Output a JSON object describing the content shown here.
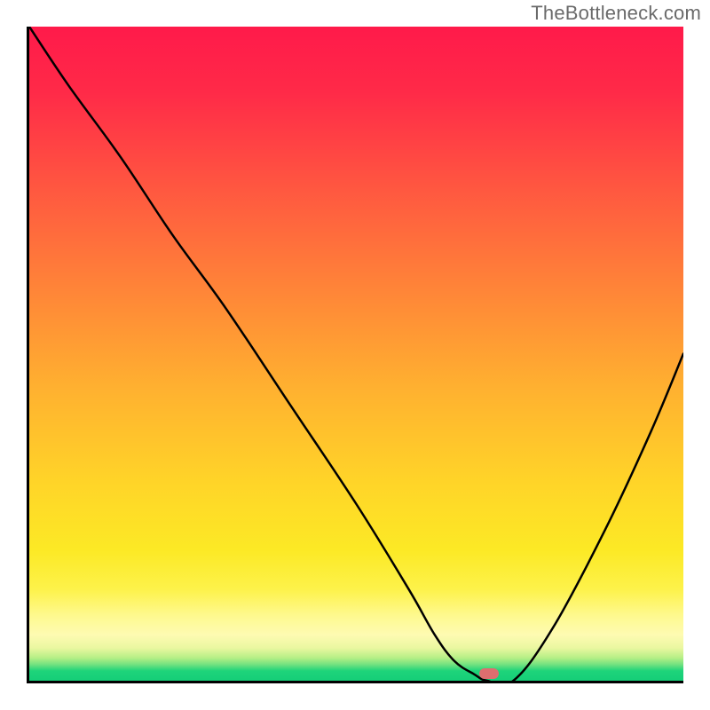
{
  "watermark": "TheBottleneck.com",
  "colors": {
    "top": "#ff1a4a",
    "mid": "#ffd528",
    "bottom": "#15ce78",
    "marker": "#de6e6f",
    "line": "#000000"
  },
  "chart_data": {
    "type": "line",
    "title": "",
    "xlabel": "",
    "ylabel": "",
    "xlim": [
      0,
      100
    ],
    "ylim": [
      0,
      100
    ],
    "grid": false,
    "series": [
      {
        "name": "curve",
        "x": [
          0,
          6,
          14,
          22,
          30,
          40,
          50,
          58,
          62,
          65,
          68,
          70,
          74,
          80,
          88,
          95,
          100
        ],
        "values": [
          100,
          91,
          80,
          68,
          57,
          42,
          27,
          14,
          7,
          3,
          1,
          0,
          0,
          8,
          23,
          38,
          50
        ]
      }
    ],
    "marker": {
      "x": 70,
      "y": 1.5
    },
    "annotations": []
  }
}
